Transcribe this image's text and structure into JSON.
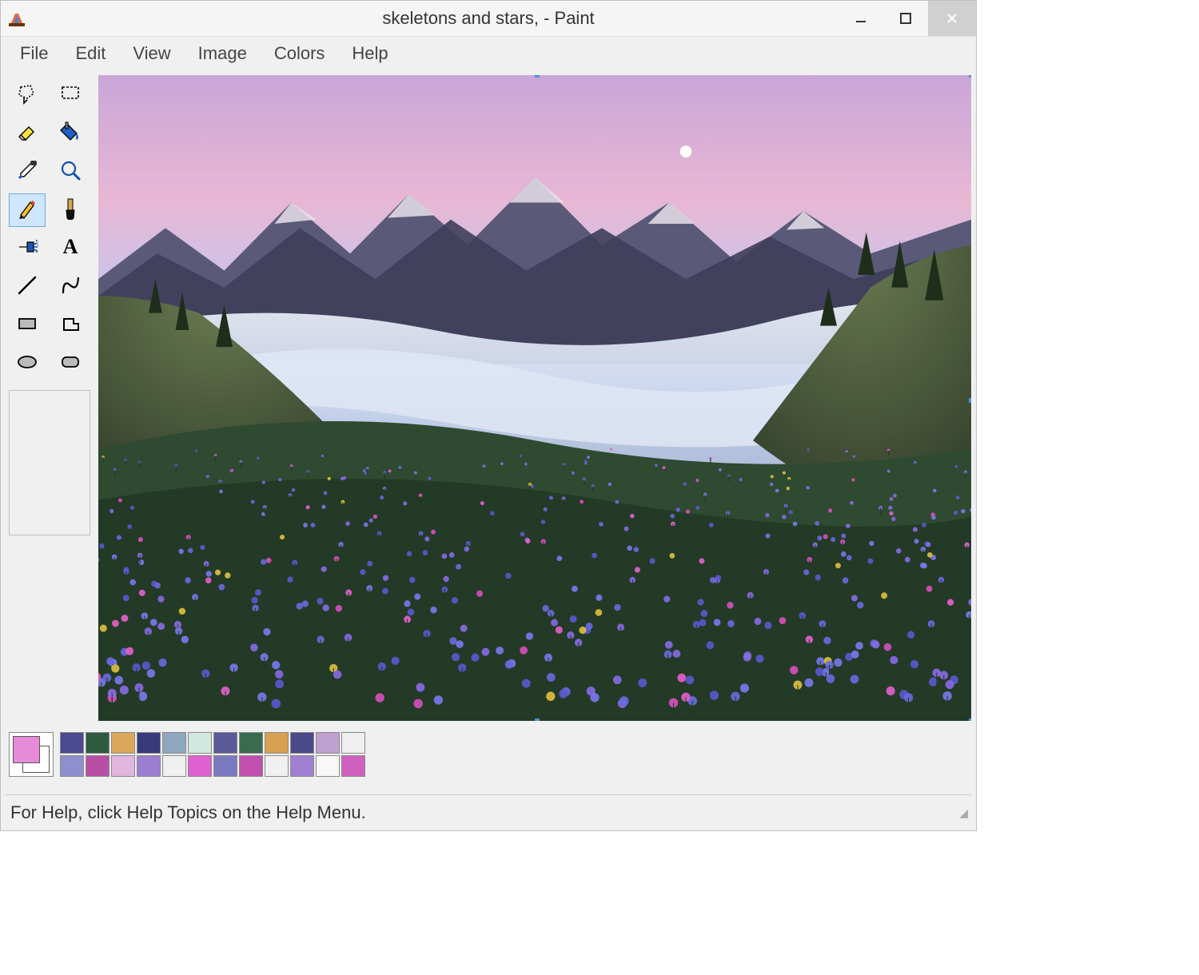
{
  "title": "skeletons and stars, - Paint",
  "menu": [
    "File",
    "Edit",
    "View",
    "Image",
    "Colors",
    "Help"
  ],
  "tools": [
    {
      "name": "free-select",
      "selected": false
    },
    {
      "name": "rect-select",
      "selected": false
    },
    {
      "name": "eraser",
      "selected": false
    },
    {
      "name": "fill",
      "selected": false
    },
    {
      "name": "pick-color",
      "selected": false
    },
    {
      "name": "magnifier",
      "selected": false
    },
    {
      "name": "pencil",
      "selected": true
    },
    {
      "name": "brush",
      "selected": false
    },
    {
      "name": "airbrush",
      "selected": false
    },
    {
      "name": "text",
      "selected": false
    },
    {
      "name": "line",
      "selected": false
    },
    {
      "name": "curve",
      "selected": false
    },
    {
      "name": "rectangle",
      "selected": false
    },
    {
      "name": "polygon",
      "selected": false
    },
    {
      "name": "ellipse",
      "selected": false
    },
    {
      "name": "rounded-rect",
      "selected": false
    }
  ],
  "foreground_color": "#e78ad8",
  "background_color": "#ffffff",
  "palette": [
    "#4a4a8f",
    "#8f8fd0",
    "#2e5a3f",
    "#b84fa5",
    "#d9a85a",
    "#e0b5e0",
    "#3a3a7a",
    "#9a7fd0",
    "#8fa8c0",
    "#f0f0f0",
    "#d0e8e0",
    "#e060d0",
    "#5a5a9a",
    "#7a7ac0",
    "#3a6a4f",
    "#c050b0",
    "#d8a050",
    "#f0f0f0",
    "#4a4a8a",
    "#a080d0",
    "#c0a0d0",
    "#f8f8f8",
    "#f0f0f0",
    "#d060c0"
  ],
  "status": "For Help, click Help Topics on the Help Menu."
}
